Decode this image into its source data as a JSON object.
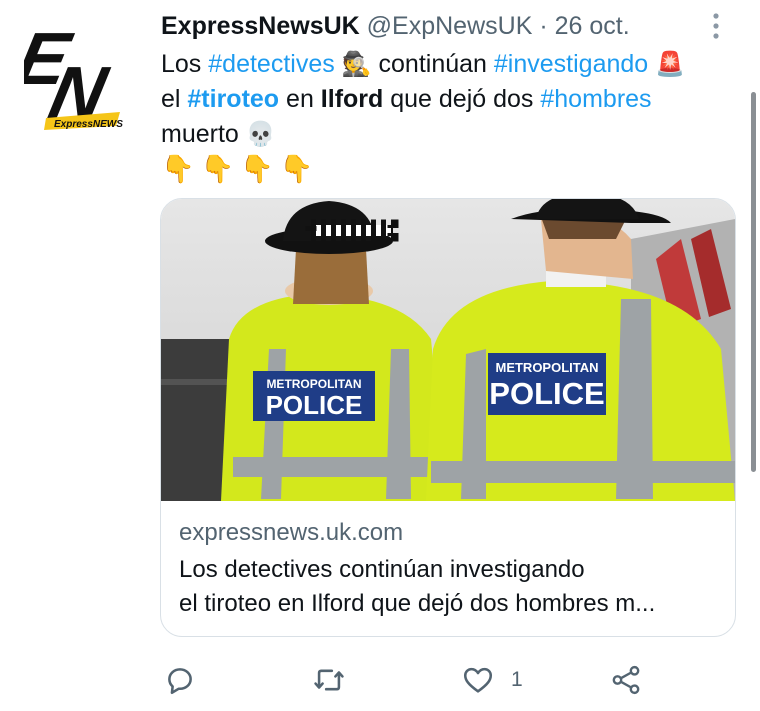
{
  "account": {
    "name": "ExpressNewsUK",
    "handle": "@ExpNewsUK",
    "separator": "·",
    "date": "26 oct."
  },
  "avatar": {
    "logo_letters": "EN",
    "logo_ribbon": "ExpressNEWS"
  },
  "tweet": {
    "w1": "Los ",
    "t1": "#detectives",
    "e1": "🕵",
    "w2": " continúan ",
    "t2": "#investigando",
    "e2": "🚨",
    "w3": "el ",
    "t3": "#tiroteo",
    "w4": " en ",
    "b1": "Ilford",
    "w5": " que dejó dos ",
    "t4": "#hombres",
    "w6": "muerto ",
    "e3": "💀",
    "e4": "👇👇👇👇"
  },
  "card": {
    "image": {
      "vest_label_line1": "METROPOLITAN",
      "vest_label_line2": "POLICE"
    },
    "domain": "expressnews.uk.com",
    "title_line1": "Los detectives continúan investigando",
    "title_line2": "el tiroteo en Ilford que dejó dos hombres m..."
  },
  "actions": {
    "reply_icon": "reply-icon",
    "retweet_icon": "retweet-icon",
    "like_icon": "heart-icon",
    "like_count": "1",
    "share_icon": "share-icon"
  },
  "colors": {
    "hashtag": "#1d9bf0",
    "muted": "#536471",
    "hivis_yellow": "#d6ea1c"
  }
}
